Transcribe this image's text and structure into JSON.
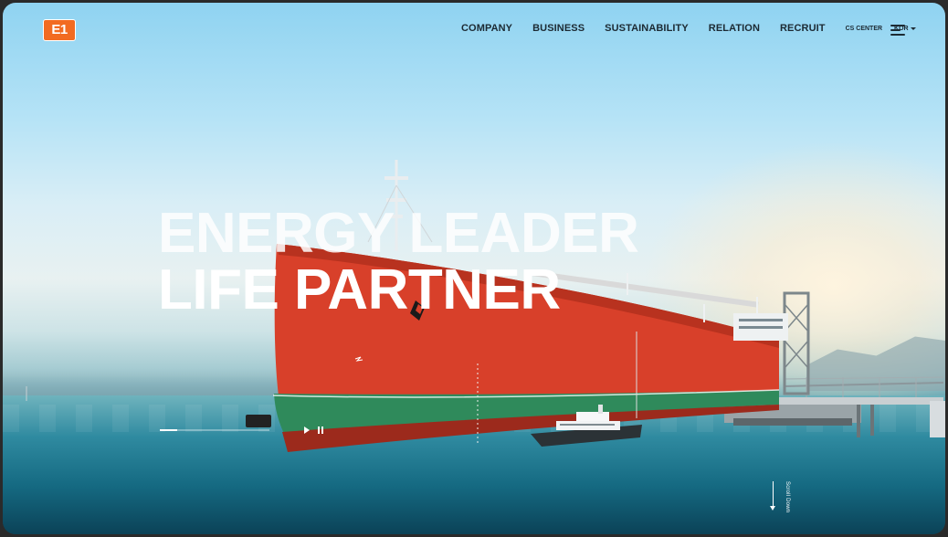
{
  "header": {
    "logo_text": "E1",
    "nav": [
      "COMPANY",
      "BUSINESS",
      "SUSTAINABILITY",
      "RELATION",
      "RECRUIT"
    ],
    "cs_center": "CS CENTER",
    "language": "KOR",
    "menu_icon": "hamburger-menu-icon"
  },
  "hero": {
    "line1": "ENERGY LEADER",
    "line2": "LIFE PARTNER",
    "slide_progress": 0.16,
    "scroll_label": "Scroll Down"
  },
  "colors": {
    "brand_orange": "#f26b21",
    "hull_red": "#d8402a",
    "hull_green": "#2f8a5b",
    "nav_text": "#1c2a33"
  }
}
